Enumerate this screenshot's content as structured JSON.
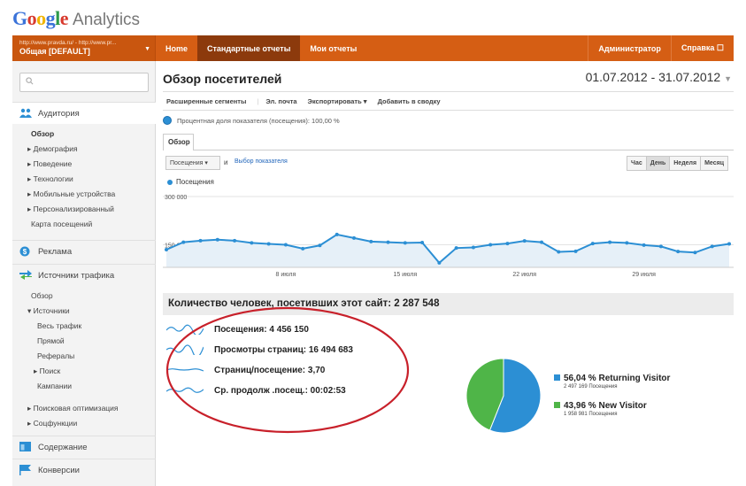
{
  "app": {
    "brand": "Google",
    "product": "Analytics"
  },
  "account": {
    "url": "http://www.pravda.ru/ - http://www.pr...",
    "name": "Общая [DEFAULT]"
  },
  "topnav": {
    "home": "Home",
    "standard": "Стандартные отчеты",
    "mine": "Мои отчеты",
    "admin": "Администратор",
    "help": "Справка ☐"
  },
  "search": {
    "placeholder": ""
  },
  "sidebar": {
    "audience": "Аудитория",
    "audience_items": [
      "Обзор",
      "▸ Демография",
      "▸ Поведение",
      "▸ Технологии",
      "▸ Мобильные устройства",
      "▸ Персонализированный",
      "Карта посещений"
    ],
    "ads": "Реклама",
    "traffic": "Источники трафика",
    "traffic_items": [
      "Обзор",
      "▾ Источники",
      "Весь трафик",
      "Прямой",
      "Рефералы",
      "▸ Поиск",
      "Кампании",
      "▸ Поисковая оптимизация",
      "▸ Соцфункции"
    ],
    "content": "Содержание",
    "conversions": "Конверсии"
  },
  "page": {
    "title": "Обзор посетителей",
    "date_range": "01.07.2012 - 31.07.2012"
  },
  "toolbar": {
    "segments": "Расширенные сегменты",
    "email": "Эл. почта",
    "export": "Экспортировать ▾",
    "add": "Добавить в сводку"
  },
  "segment_pct": "Процентная доля показателя (посещения): 100,00 %",
  "tab_overview": "Обзор",
  "metric_select": "Посещения",
  "and_label": "и",
  "pick_metric": "Выбор показателя",
  "periods": [
    "Час",
    "День",
    "Неделя",
    "Месяц"
  ],
  "chart_data": {
    "type": "line",
    "series": [
      {
        "name": "Посещения",
        "values": [
          135000,
          158000,
          163000,
          166000,
          163000,
          156000,
          153000,
          150000,
          138000,
          148000,
          182000,
          171000,
          160000,
          158000,
          156000,
          157000,
          94000,
          140000,
          142000,
          150000,
          154000,
          162000,
          158000,
          128000,
          130000,
          154000,
          158000,
          156000,
          149000,
          145000,
          129000,
          126000,
          145000,
          153000
        ]
      }
    ],
    "y_ticks": [
      "300 000",
      "150 000"
    ],
    "ylim": [
      80000,
      300000
    ],
    "x_tick_labels": [
      "8 июля",
      "15 июля",
      "22 июля",
      "29 июля"
    ],
    "x_tick_index": [
      7,
      14,
      21,
      28
    ],
    "color": "#2c8fd4"
  },
  "summary": "Количество человек, посетивших этот сайт: 2 287 548",
  "metrics": [
    {
      "label": "Посещения: 4 456 150"
    },
    {
      "label": "Просмотры страниц: 16 494 683"
    },
    {
      "label": "Страниц/посещение: 3,70"
    },
    {
      "label": "Ср. продолж .посещ.: 00:02:53"
    }
  ],
  "pie": {
    "slices": [
      {
        "pct": "56,04 %",
        "name": "Returning Visitor",
        "sub": "2 497 169 Посещения",
        "value": 56.04,
        "color": "#2c8fd4"
      },
      {
        "pct": "43,96 %",
        "name": "New Visitor",
        "sub": "1 958 981 Посещения",
        "value": 43.96,
        "color": "#4fb548"
      }
    ]
  }
}
